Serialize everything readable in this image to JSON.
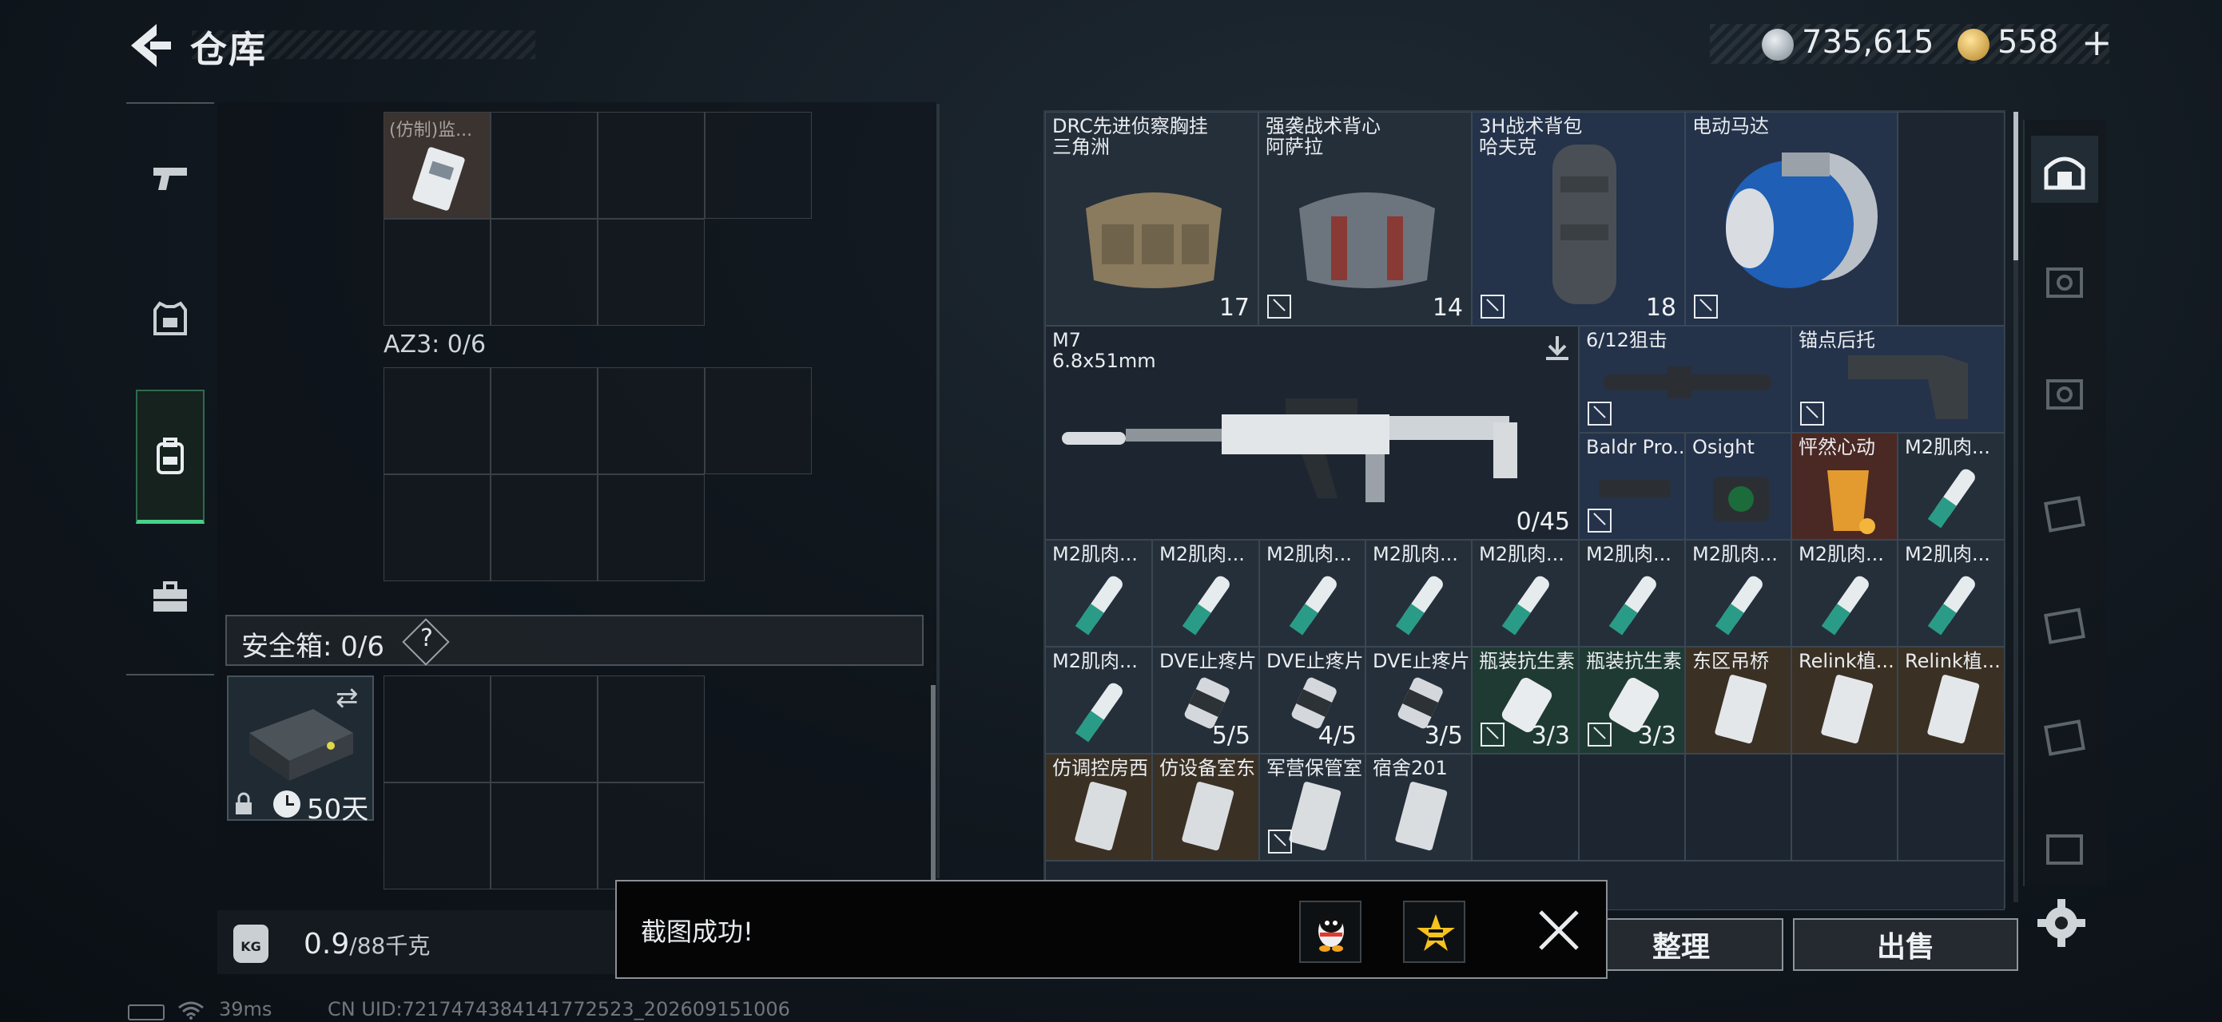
{
  "header": {
    "title": "仓库"
  },
  "currency": {
    "silver": "735,615",
    "gold": "558",
    "plus_label": "+"
  },
  "left_rail": {
    "items": [
      "pistol-icon",
      "armor-icon",
      "backpack-icon",
      "toolbox-icon"
    ]
  },
  "left_panel": {
    "item_top": {
      "name": "(仿制)监..."
    },
    "container_label": "AZ3: 0/6",
    "safe_label": "安全箱: 0/6",
    "help_label": "?",
    "expire_label": "50天"
  },
  "weight": {
    "value": "0.9",
    "unit": "/88千克",
    "icon_text": "KG"
  },
  "stash": {
    "items": [
      {
        "name": "DRC先进侦察胸挂\n三角洲",
        "count": "17"
      },
      {
        "name": "强袭战术背心\n阿萨拉",
        "count": "14"
      },
      {
        "name": "3H战术背包\n哈夫克",
        "count": "18"
      },
      {
        "name": "电动马达",
        "count": ""
      },
      {
        "name": "M7\n6.8x51mm",
        "count": "0/45"
      },
      {
        "name": "6/12狙击",
        "count": ""
      },
      {
        "name": "锚点后托",
        "count": ""
      },
      {
        "name": "Baldr Pro...",
        "count": ""
      },
      {
        "name": "Osight",
        "count": ""
      },
      {
        "name": "怦然心动",
        "count": ""
      },
      {
        "name": "M2肌肉...",
        "count": ""
      },
      {
        "name": "DVE止疼片",
        "count": "5/5"
      },
      {
        "name": "DVE止疼片",
        "count": "4/5"
      },
      {
        "name": "DVE止疼片",
        "count": "3/5"
      },
      {
        "name": "瓶装抗生素",
        "count": "3/3"
      },
      {
        "name": "瓶装抗生素",
        "count": "3/3"
      },
      {
        "name": "东区吊桥",
        "count": ""
      },
      {
        "name": "Relink植...",
        "count": ""
      },
      {
        "name": "Relink植...",
        "count": ""
      },
      {
        "name": "仿调控房西",
        "count": ""
      },
      {
        "name": "仿设备室东",
        "count": ""
      },
      {
        "name": "军营保管室",
        "count": ""
      },
      {
        "name": "宿舍201",
        "count": ""
      }
    ]
  },
  "buttons": {
    "sort": "整理",
    "sell": "出售"
  },
  "toast": {
    "message": "截图成功!"
  },
  "status": {
    "ping": "39ms",
    "uid": "CN UID:7217474384141772523_202609151006"
  }
}
